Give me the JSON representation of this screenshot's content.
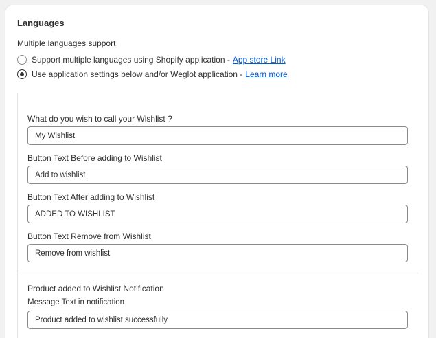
{
  "languages": {
    "title": "Languages",
    "subtitle": "Multiple languages support",
    "options": [
      {
        "text": "Support multiple languages using Shopify application -",
        "link": "App store Link",
        "checked": false
      },
      {
        "text": "Use application settings below and/or Weglot application -",
        "link": "Learn more",
        "checked": true
      }
    ]
  },
  "fields": [
    {
      "label": "What do you wish to call your Wishlist ?",
      "value": "My Wishlist"
    },
    {
      "label": "Button Text Before adding to Wishlist",
      "value": "Add to wishlist"
    },
    {
      "label": "Button Text After adding to Wishlist",
      "value": "ADDED TO WISHLIST"
    },
    {
      "label": "Button Text Remove from Wishlist",
      "value": "Remove from wishlist"
    }
  ],
  "notification": {
    "title": "Product added to Wishlist Notification",
    "message_label": "Message Text in notification",
    "message_value": "Product added to wishlist successfully"
  }
}
